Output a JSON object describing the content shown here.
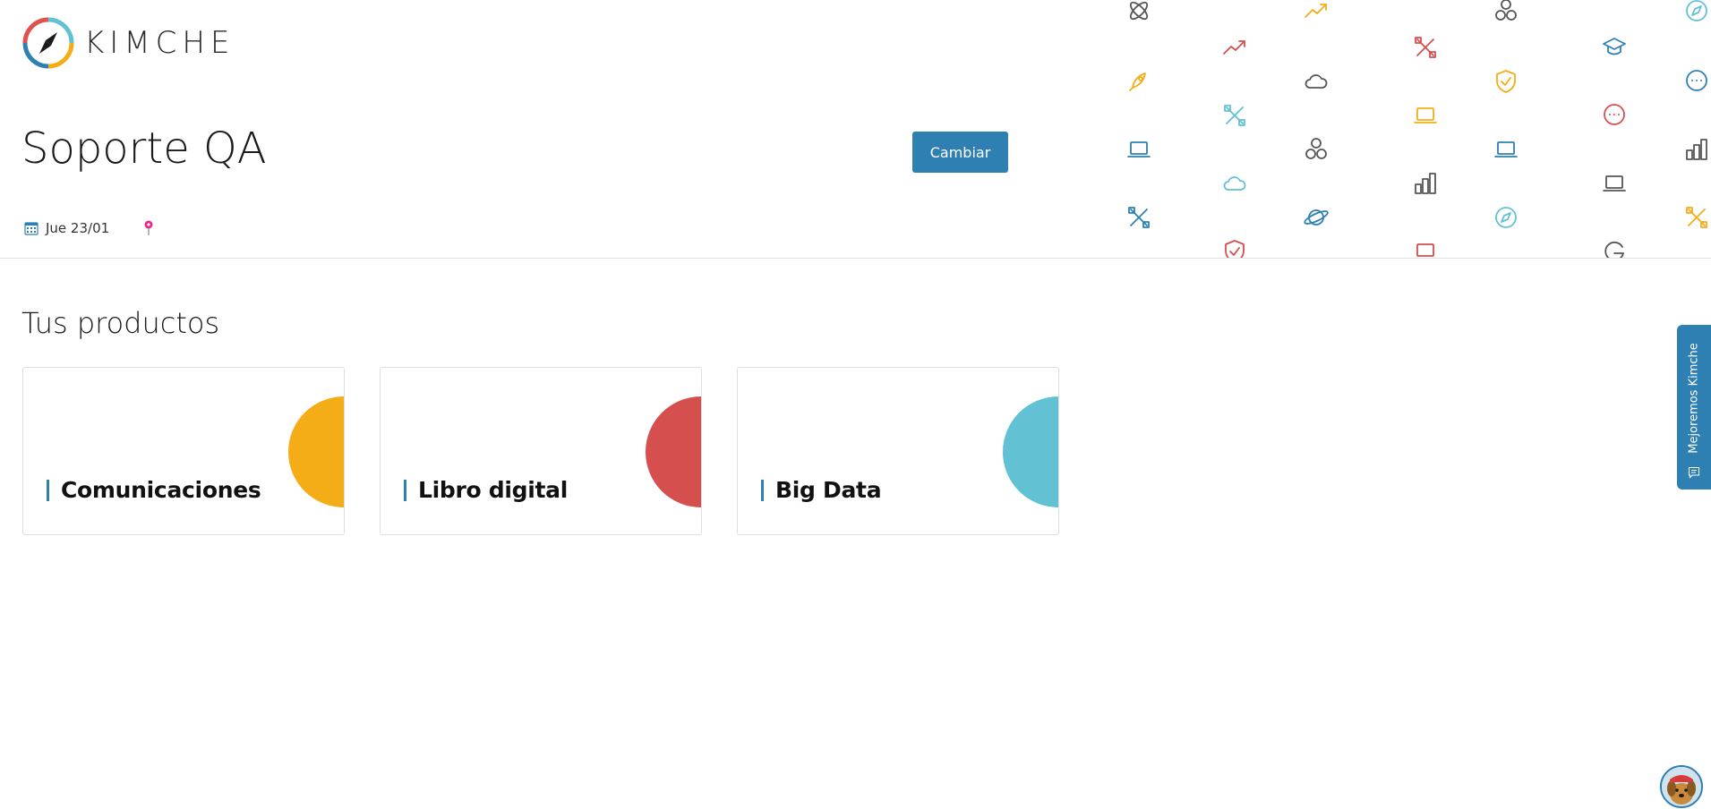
{
  "brand": {
    "name": "KIMCHE",
    "logo_colors": [
      "#e0524f",
      "#62c2d4",
      "#f5ad17",
      "#2e80b3"
    ]
  },
  "header": {
    "title": "Soporte QA",
    "change_button": "Cambiar",
    "date": "Jue 23/01",
    "calendar_icon": "calendar-icon",
    "location_icon": "map-pin-icon"
  },
  "products": {
    "title": "Tus productos",
    "items": [
      {
        "name": "Comunicaciones",
        "color": "#f5ad17"
      },
      {
        "name": "Libro digital",
        "color": "#d64f4f"
      },
      {
        "name": "Big Data",
        "color": "#62c2d4"
      }
    ]
  },
  "feedback": {
    "label": "Mejoremos Kimche",
    "icon": "comment-icon"
  },
  "avatar": {
    "icon": "dog-avatar-icon"
  },
  "colors": {
    "accent": "#2e80b3",
    "yellow": "#f5ad17",
    "red": "#d64f4f",
    "cyan": "#62c2d4",
    "gray": "#555555"
  }
}
